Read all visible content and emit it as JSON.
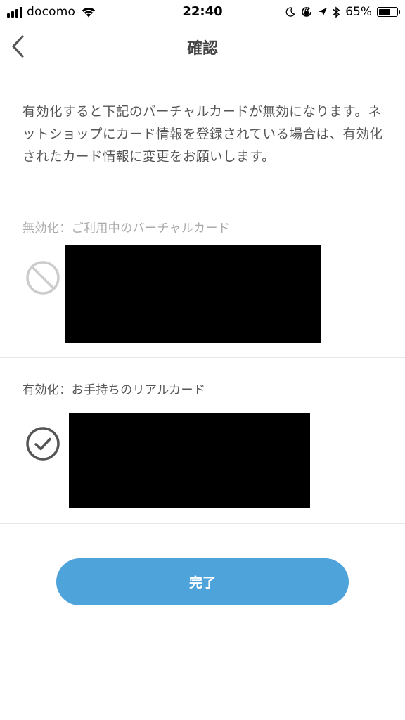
{
  "status_bar": {
    "carrier": "docomo",
    "time": "22:40",
    "battery_percent": "65%",
    "battery_level": 0.65,
    "icons": [
      "signal-icon",
      "wifi-icon",
      "moon-icon",
      "orientation-lock-icon",
      "location-icon",
      "bluetooth-icon",
      "battery-icon"
    ]
  },
  "nav": {
    "back_icon": "chevron-left-icon",
    "title": "確認"
  },
  "description": "有効化すると下記のバーチャルカードが無効になります。ネットショップにカード情報を登録されている場合は、有効化されたカード情報に変更をお願いします。",
  "virtual_card": {
    "label": "無効化：ご利用中のバーチャルカード",
    "icon": "prohibited-icon",
    "icon_color": "#cccccc"
  },
  "real_card": {
    "label": "有効化：お手持ちのリアルカード",
    "icon": "check-circle-icon",
    "icon_color": "#555555"
  },
  "done_button": {
    "label": "完了",
    "color": "#4fa3db"
  }
}
